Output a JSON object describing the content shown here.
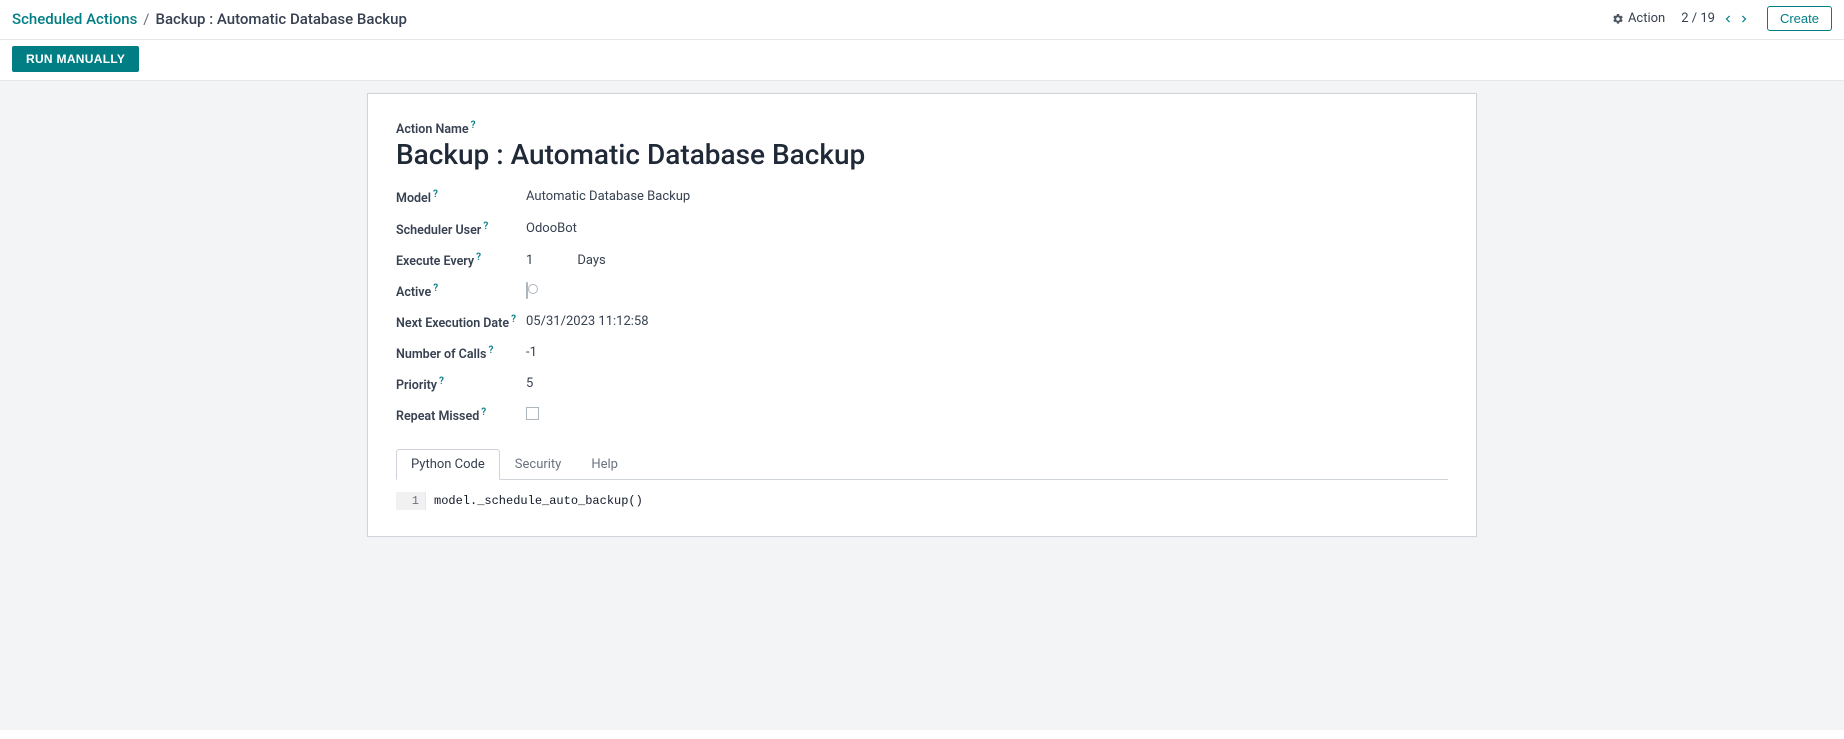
{
  "breadcrumb": {
    "root": "Scheduled Actions",
    "current": "Backup : Automatic Database Backup"
  },
  "header": {
    "action_label": "Action",
    "pager": "2 / 19",
    "create_label": "Create"
  },
  "toolbar": {
    "run_manually": "RUN MANUALLY"
  },
  "form": {
    "action_name_label": "Action Name",
    "action_name_value": "Backup : Automatic Database Backup",
    "rows": {
      "model_label": "Model",
      "model_value": "Automatic Database Backup",
      "scheduler_user_label": "Scheduler User",
      "scheduler_user_value": "OdooBot",
      "execute_every_label": "Execute Every",
      "execute_every_number": "1",
      "execute_every_unit": "Days",
      "active_label": "Active",
      "active_value": false,
      "next_exec_label": "Next Execution Date",
      "next_exec_value": "05/31/2023 11:12:58",
      "num_calls_label": "Number of Calls",
      "num_calls_value": "-1",
      "priority_label": "Priority",
      "priority_value": "5",
      "repeat_missed_label": "Repeat Missed",
      "repeat_missed_value": false
    }
  },
  "tabs": {
    "python_code": "Python Code",
    "security": "Security",
    "help": "Help"
  },
  "code": {
    "line_number": "1",
    "content": "model._schedule_auto_backup()"
  }
}
